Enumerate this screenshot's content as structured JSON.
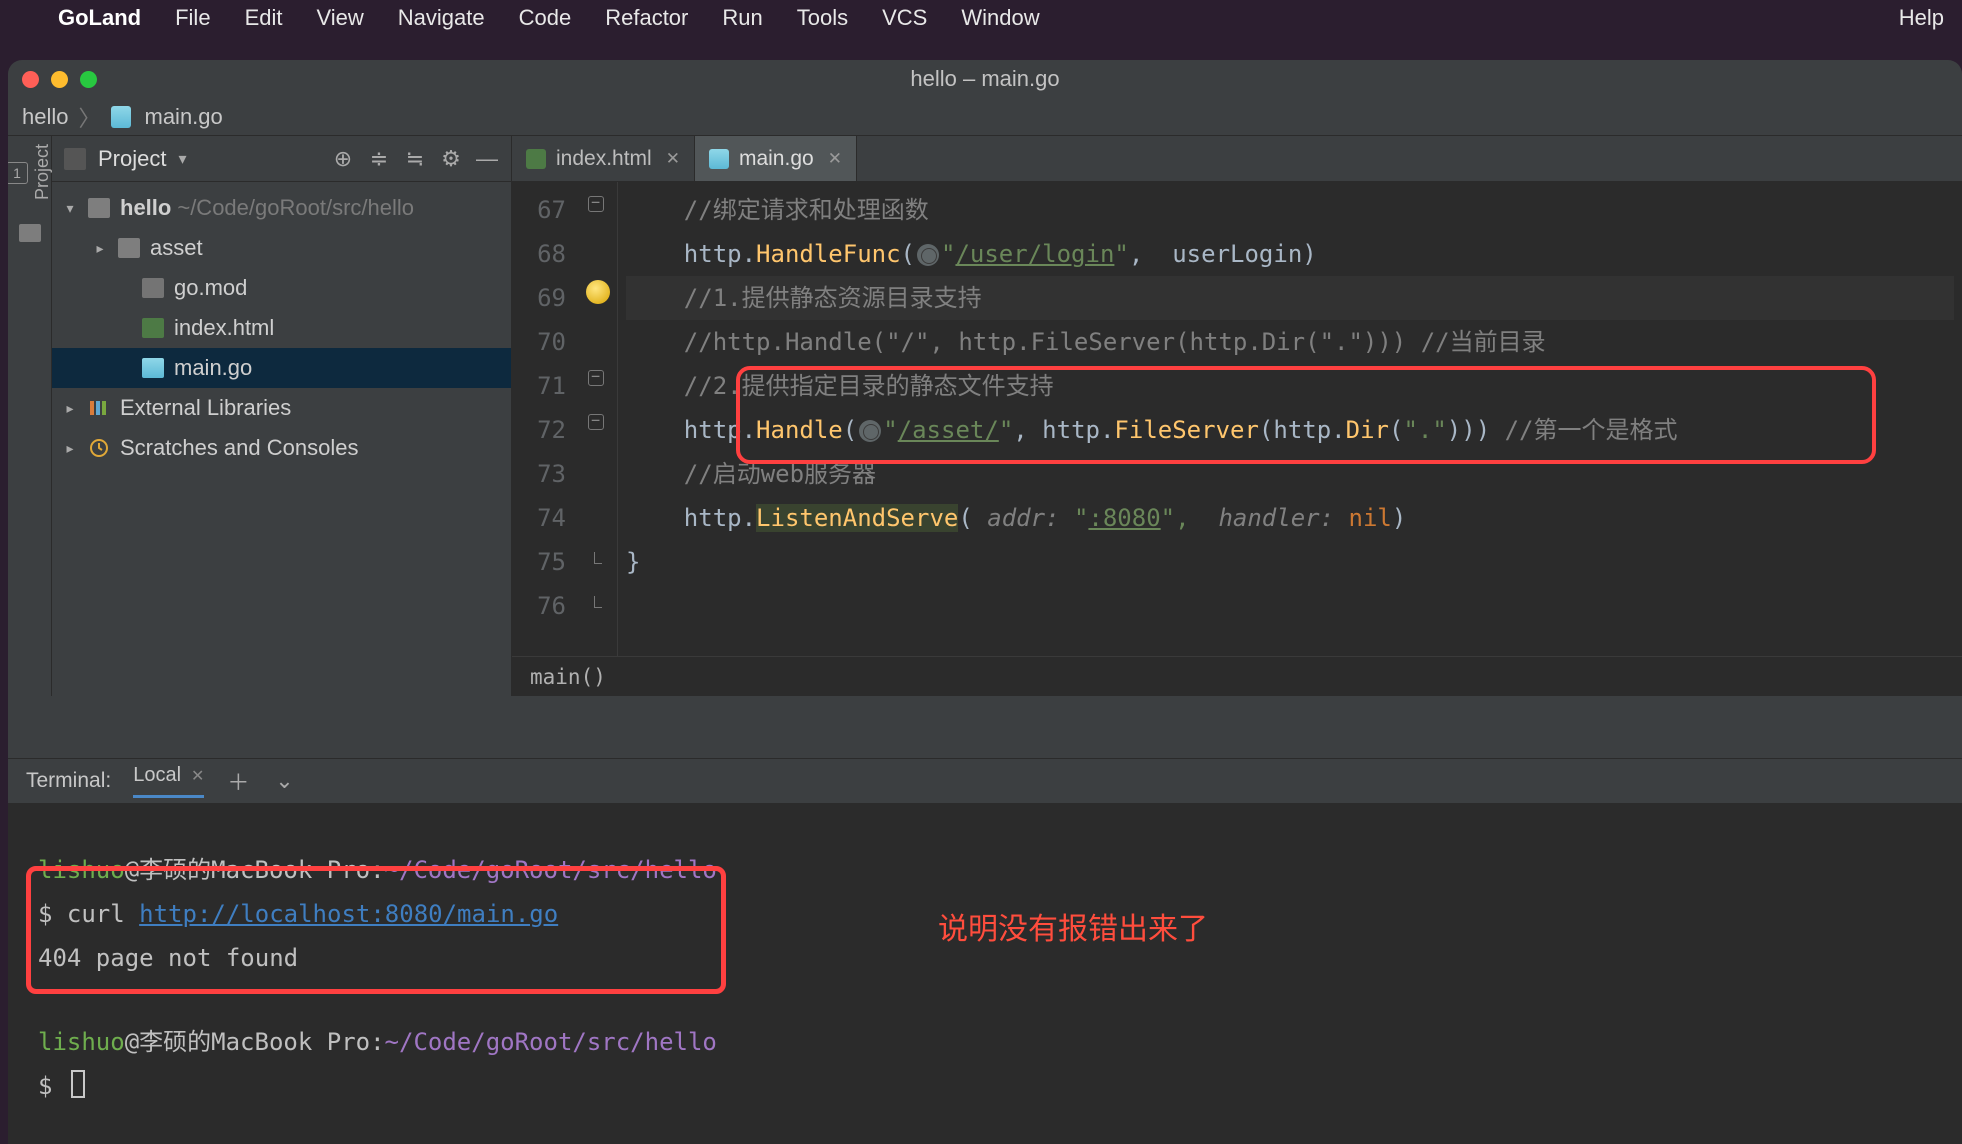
{
  "menubar": {
    "app": "GoLand",
    "items": [
      "File",
      "Edit",
      "View",
      "Navigate",
      "Code",
      "Refactor",
      "Run",
      "Tools",
      "VCS",
      "Window"
    ],
    "help": "Help"
  },
  "window": {
    "title": "hello – main.go"
  },
  "breadcrumbs": {
    "project": "hello",
    "file": "main.go"
  },
  "project_toolbar": {
    "label": "Project"
  },
  "tree": {
    "root": {
      "name": "hello",
      "path": "~/Code/goRoot/src/hello"
    },
    "asset": "asset",
    "go_mod": "go.mod",
    "index_html": "index.html",
    "main_go": "main.go",
    "ext_libs": "External Libraries",
    "scratches": "Scratches and Consoles"
  },
  "tabs": {
    "index": "index.html",
    "main": "main.go"
  },
  "editor": {
    "lines": [
      "67",
      "68",
      "69",
      "70",
      "71",
      "72",
      "73",
      "74",
      "75",
      "76"
    ],
    "l67c": "//绑定请求和处理函数",
    "l68a": "http.",
    "l68b": "HandleFunc",
    "l68c": "(",
    "l68d": "\"",
    "l68e": "/user/login",
    "l68f": "\"",
    "l68g": ",  ",
    "l68h": "userLogin",
    "l68i": ")",
    "l69c": "//1.提供静态资源目录支持",
    "l70c": "//http.Handle(\"/\", http.FileServer(http.Dir(\".\"))) //当前目录",
    "l71c": "//2.提供指定目录的静态文件支持",
    "l72a": "http.",
    "l72b": "Handle",
    "l72c": "(",
    "l72d": "\"",
    "l72e": "/asset/",
    "l72f": "\"",
    "l72g": ", http.",
    "l72h": "FileServer",
    "l72i": "(http.",
    "l72j": "Dir",
    "l72k": "(",
    "l72l": "\".\"",
    "l72m": "))) ",
    "l72n": "//第一个是格式",
    "l73c": "//启动web服务器",
    "l74a": "http.",
    "l74b": "ListenAndServe",
    "l74c": "( ",
    "l74d": "addr:",
    "l74e": " \"",
    "l74f": ":8080",
    "l74g": "\",  ",
    "l74h": "handler:",
    "l74i": " ",
    "l74j": "nil",
    "l74k": ")",
    "l75": "}",
    "breadcrumb": "main()"
  },
  "terminal": {
    "title": "Terminal:",
    "tab": "Local",
    "user": "lishuo",
    "host": "@李硕的MacBook Pro",
    "colon": ":",
    "path": "~/Code/goRoot/src/hello",
    "prompt": "$ ",
    "cmd": "curl ",
    "url": "http://localhost:8080/main.go",
    "resp": "404 page not found",
    "annotation": "说明没有报错出来了"
  }
}
